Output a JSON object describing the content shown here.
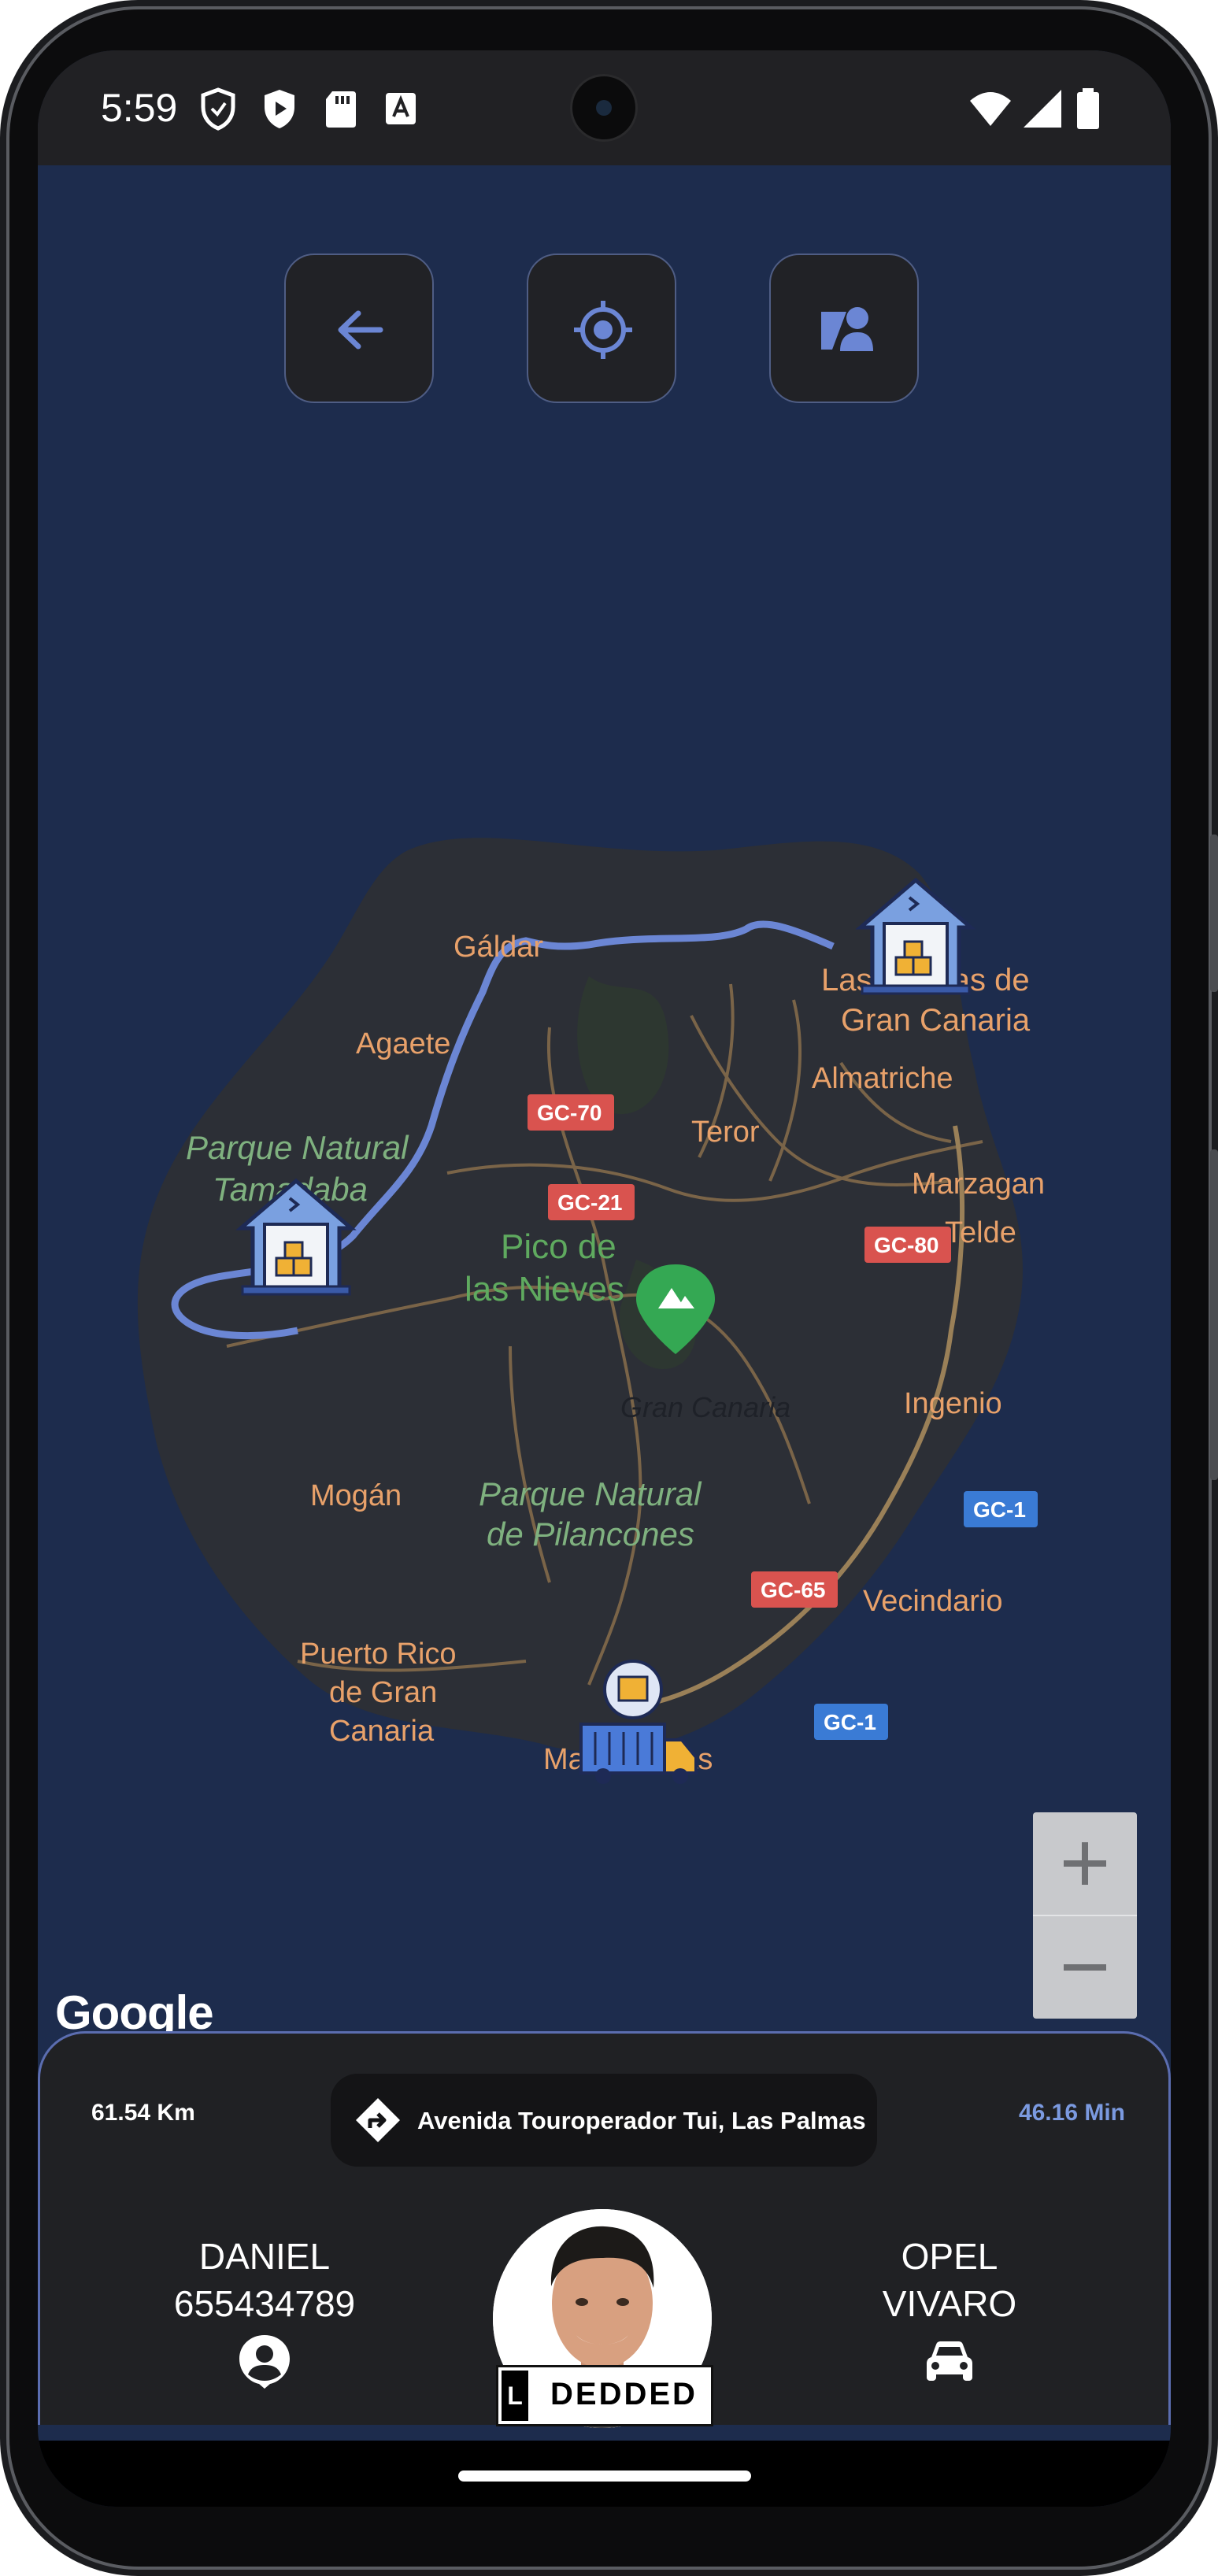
{
  "status_bar": {
    "time": "5:59",
    "left_icons": [
      "shield-outline-icon",
      "shield-play-icon",
      "sd-card-icon",
      "keyboard-a-icon"
    ],
    "right_icons": [
      "wifi-icon",
      "cell-signal-icon",
      "battery-icon"
    ]
  },
  "map": {
    "background": "#1d2c4d",
    "land": "#2c2f36",
    "route_color": "#6b86d4",
    "label_color": "#e8a16a",
    "park_label_color": "#7fb17f",
    "labels": {
      "galdar": "Gáldar",
      "agaete": "Agaete",
      "palmas_1": "Las Palmas de",
      "palmas_2": "Gran Canaria",
      "almatriche": "Almatriche",
      "teror": "Teror",
      "marzagan": "Marzagan",
      "telde": "Telde",
      "tamadaba_1": "Parque Natural",
      "tamadaba_2": "Tamadaba",
      "pico_1": "Pico de",
      "pico_2": "las Nieves",
      "gran_canaria": "Gran Canaria",
      "ingenio": "Ingenio",
      "mogan": "Mogán",
      "pilancones_1": "Parque Natural",
      "pilancones_2": "de Pilancones",
      "vecindario": "Vecindario",
      "puerto_1": "Puerto Rico",
      "puerto_2": "de Gran",
      "puerto_3": "Canaria",
      "maspalomas": "Maspalomas"
    },
    "road_badges": {
      "gc70": "GC-70",
      "gc21": "GC-21",
      "gc80": "GC-80",
      "gc1a": "GC-1",
      "gc65": "GC-65",
      "gc1b": "GC-1"
    },
    "controls": {
      "zoom_in": "+",
      "zoom_out": "−"
    },
    "attribution": "Google"
  },
  "top_buttons": {
    "back": "arrow-back-icon",
    "locate": "my-location-icon",
    "profile": "profile-shapes-icon"
  },
  "trip": {
    "distance": "61.54 Km",
    "address": "Avenida Touroperador Tui, Las Palmas",
    "duration": "46.16 Min"
  },
  "driver": {
    "first_name": "DANIEL",
    "phone": "655434789",
    "plate_prefix": "L",
    "plate": "DEDDED"
  },
  "vehicle": {
    "make": "OPEL",
    "model": "VIVARO"
  }
}
